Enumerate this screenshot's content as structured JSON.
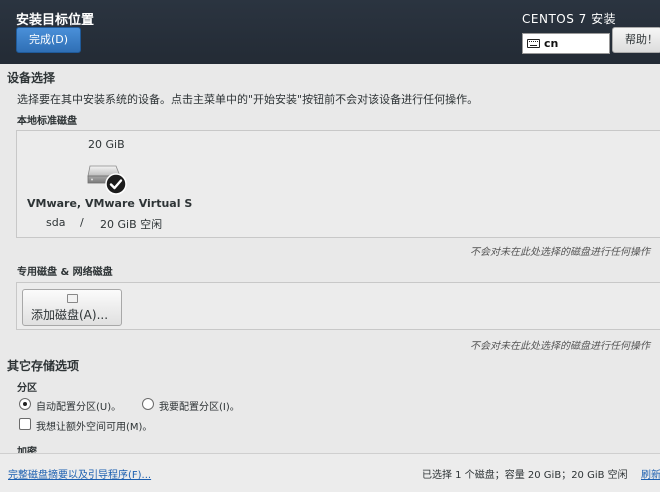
{
  "header": {
    "title": "安装目标位置",
    "done_label": "完成(D)",
    "product": "CENTOS 7 安装",
    "keyboard_layout": "cn",
    "help_label": "帮助！"
  },
  "device_selection": {
    "title": "设备选择",
    "description": "选择要在其中安装系统的设备。点击主菜单中的\"开始安装\"按钮前不会对该设备进行任何操作。",
    "local_label": "本地标准磁盘",
    "disk": {
      "size": "20 GiB",
      "name": "VMware, VMware Virtual S",
      "device": "sda",
      "separator": "/",
      "free": "20 GiB 空闲",
      "selected": true
    },
    "local_note": "不会对未在此处选择的磁盘进行任何操作",
    "special_label": "专用磁盘 & 网络磁盘",
    "add_disk_label": "添加磁盘(A)...",
    "special_note": "不会对未在此处选择的磁盘进行任何操作"
  },
  "other_options": {
    "title": "其它存储选项",
    "partition_label": "分区",
    "auto_partition": "自动配置分区(U)。",
    "manual_partition": "我要配置分区(I)。",
    "selected_partition": "auto",
    "extra_space": "我想让额外空间可用(M)。",
    "extra_space_checked": false,
    "encryption_label": "加密"
  },
  "footer": {
    "summary_link": "完整磁盘摘要以及引导程序(F)...",
    "status": "已选择 1 个磁盘；容量 20 GiB；20 GiB 空闲",
    "refresh_link": "刷新"
  },
  "colors": {
    "header_bg": "#2b3440",
    "accent_blue": "#2f6fb5",
    "link": "#1c5fb0",
    "page_bg": "#e9e9e9"
  }
}
